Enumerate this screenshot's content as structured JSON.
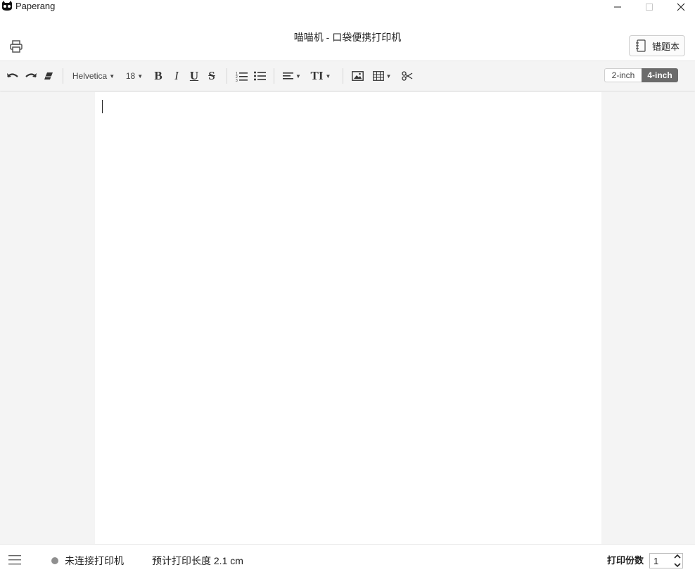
{
  "window": {
    "app_title": "Paperang",
    "controls": [
      "minimize-icon",
      "maximize-icon",
      "close-icon"
    ]
  },
  "header": {
    "title": "喵喵机 - 口袋便携打印机",
    "notebook_button_label": "错题本",
    "print_icon": "printer-icon"
  },
  "toolbar": {
    "font_family": "Helvetica",
    "font_size": "18",
    "bold_label": "B",
    "italic_label": "I",
    "underline_label": "U",
    "strike_label": "S",
    "text_size_label": "TI",
    "paper_sizes": [
      "2-inch",
      "4-inch"
    ],
    "selected_paper_size": "4-inch",
    "icons": [
      "undo-icon",
      "redo-icon",
      "eraser-icon",
      "ordered-list-icon",
      "unordered-list-icon",
      "align-icon",
      "text-height-icon",
      "image-icon",
      "table-icon",
      "scissors-icon"
    ]
  },
  "editor": {
    "content": ""
  },
  "status": {
    "menu_icon": "menu-icon",
    "connection_text": "未连接打印机",
    "length_text": "预计打印长度 2.1 cm",
    "copies_label": "打印份数",
    "copies_value": "1"
  },
  "colors": {
    "toolbar_bg": "#f4f4f4",
    "selected_segment": "#6b6b6b",
    "status_dot": "#8f8f8f"
  }
}
